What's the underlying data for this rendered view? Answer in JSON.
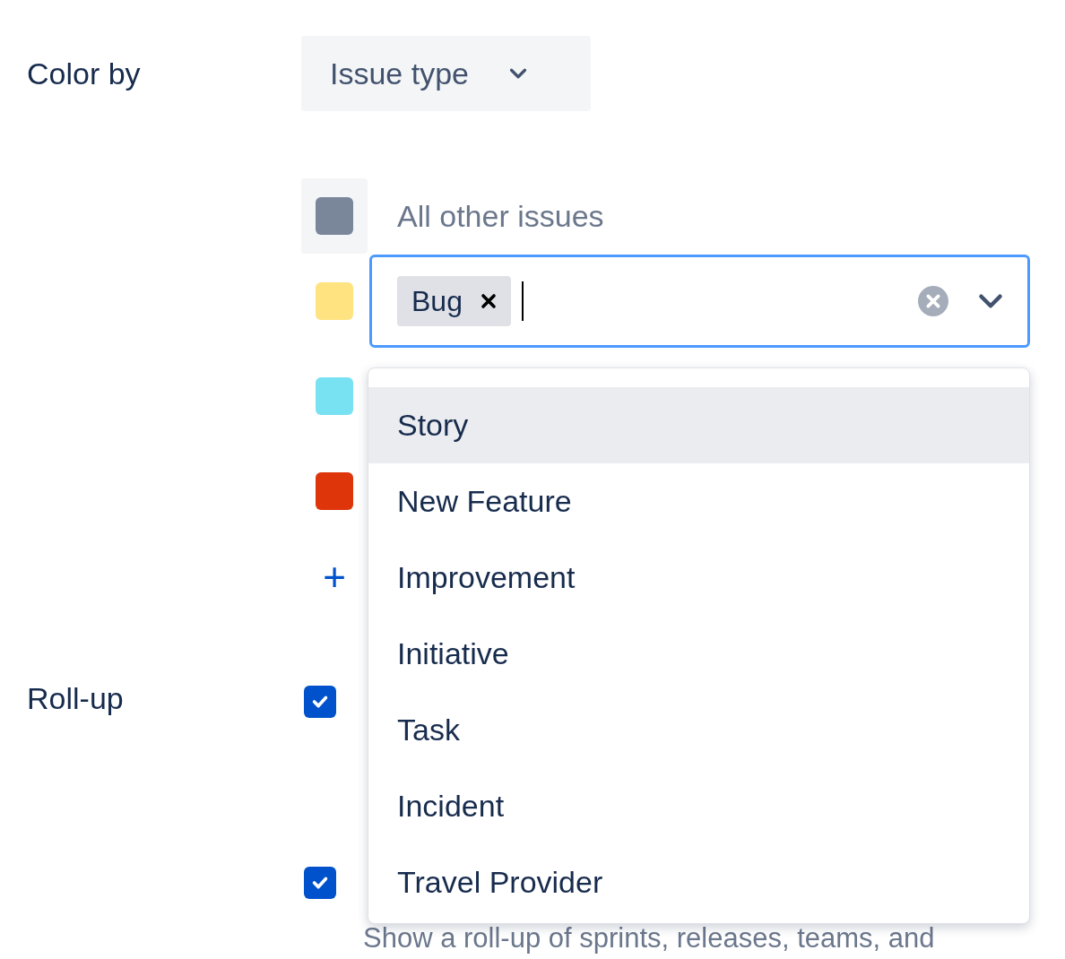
{
  "color_by": {
    "label": "Color by",
    "value": "Issue type"
  },
  "color_rules": [
    {
      "kind": "default",
      "color": "#7a869a",
      "label": "All other issues"
    },
    {
      "kind": "select",
      "color": "#ffe380",
      "tags": [
        "Bug"
      ]
    },
    {
      "kind": "covered",
      "color": "#79e2f2"
    },
    {
      "kind": "covered",
      "color": "#de350b"
    }
  ],
  "add_rule": {
    "label": "+"
  },
  "rollup": {
    "label": "Roll-up",
    "options": [
      {
        "checked": true
      },
      {
        "checked": true,
        "description": "Show a roll-up of sprints, releases, teams, and"
      }
    ]
  },
  "menu": {
    "options": [
      {
        "label": "Story",
        "selected": true
      },
      {
        "label": "New Feature",
        "selected": false
      },
      {
        "label": "Improvement",
        "selected": false
      },
      {
        "label": "Initiative",
        "selected": false
      },
      {
        "label": "Task",
        "selected": false
      },
      {
        "label": "Incident",
        "selected": false
      },
      {
        "label": "Travel Provider",
        "selected": false
      }
    ]
  }
}
